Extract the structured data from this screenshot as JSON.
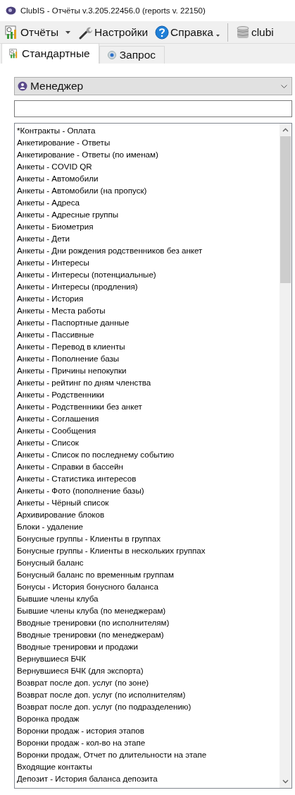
{
  "window": {
    "title": "ClubIS - Отчёты v.3.205.22456.0 (reports v. 22150)"
  },
  "toolbar": [
    {
      "kind": "menu",
      "label": "Отчёты"
    },
    {
      "kind": "button",
      "label": "Настройки"
    },
    {
      "kind": "menu-small",
      "label": "Справка"
    },
    {
      "kind": "separator"
    },
    {
      "kind": "button",
      "label": "clubi"
    }
  ],
  "tabs": [
    {
      "label": "Стандартные",
      "selected": true
    },
    {
      "label": "Запрос",
      "selected": false
    }
  ],
  "role_select": {
    "value": "Менеджер"
  },
  "reports": [
    "*Контракты - Оплата",
    "Анкетирование - Ответы",
    "Анкетирование - Ответы (по именам)",
    "Анкеты - COVID QR",
    "Анкеты - Автомобили",
    "Анкеты - Автомобили (на пропуск)",
    "Анкеты - Адреса",
    "Анкеты - Адресные группы",
    "Анкеты - Биометрия",
    "Анкеты - Дети",
    "Анкеты - Дни рождения родственников без анкет",
    "Анкеты - Интересы",
    "Анкеты - Интересы (потенциальные)",
    "Анкеты - Интересы (продления)",
    "Анкеты - История",
    "Анкеты - Места работы",
    "Анкеты - Паспортные данные",
    "Анкеты - Пассивные",
    "Анкеты - Перевод в клиенты",
    "Анкеты - Пополнение базы",
    "Анкеты - Причины непокупки",
    "Анкеты - рейтинг по дням членства",
    "Анкеты - Родственники",
    "Анкеты - Родственники без анкет",
    "Анкеты - Соглашения",
    "Анкеты - Сообщения",
    "Анкеты - Список",
    "Анкеты - Список по последнему событию",
    "Анкеты - Справки в бассейн",
    "Анкеты - Статистика интересов",
    "Анкеты - Фото (пополнение базы)",
    "Анкеты - Чёрный список",
    "Архивирование блоков",
    "Блоки - удаление",
    "Бонусные группы - Клиенты в группах",
    "Бонусные группы - Клиенты в нескольких группах",
    "Бонусный баланс",
    "Бонусный баланс по временным группам",
    "Бонусы - История бонусного баланса",
    "Бывшие члены клуба",
    "Бывшие члены клуба (по менеджерам)",
    "Вводные тренировки (по исполнителям)",
    "Вводные тренировки (по менеджерам)",
    "Вводные тренировки и продажи",
    "Вернувшиеся БЧК",
    "Вернувшиеся БЧК (для экспорта)",
    "Возврат после доп. услуг (по зоне)",
    "Возврат после доп. услуг (по исполнителям)",
    "Возврат после доп. услуг (по подразделению)",
    "Воронка продаж",
    "Воронки продаж - история этапов",
    "Воронки продаж - кол-во на этапе",
    "Воронки продаж, Отчет по длительности на этапе",
    "Входящие контакты",
    "Депозит - История баланса депозита"
  ]
}
